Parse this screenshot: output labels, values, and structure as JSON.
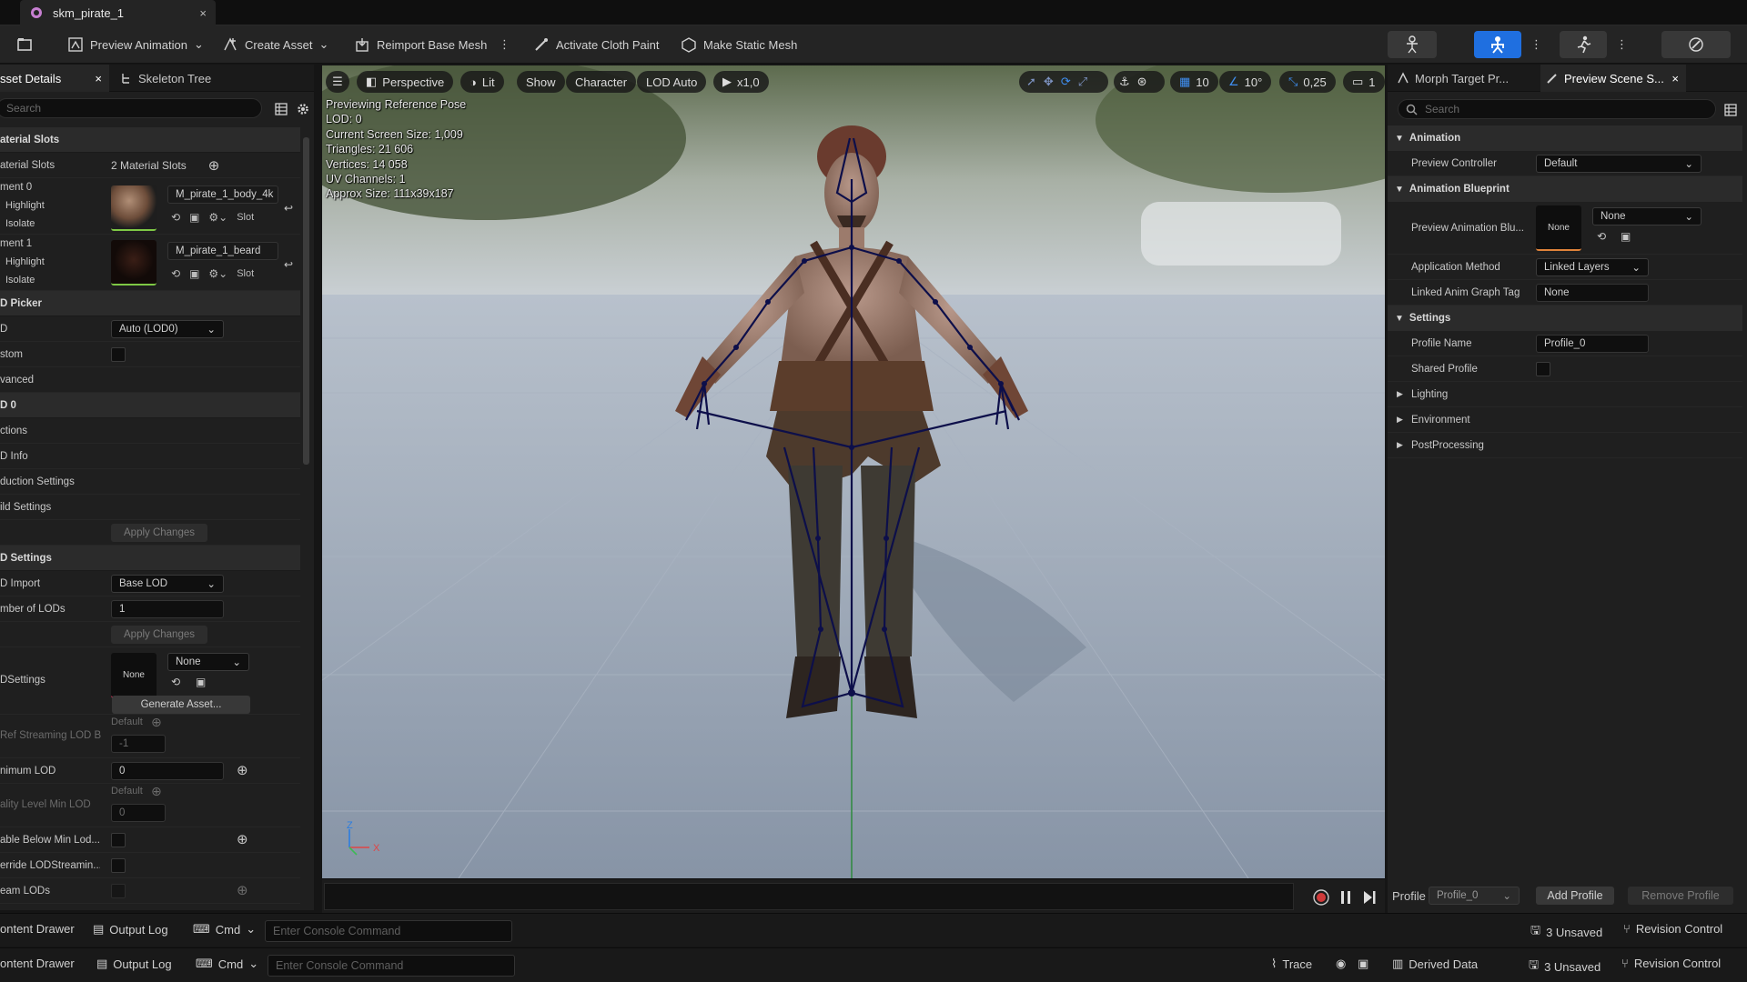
{
  "tab": {
    "title": "skm_pirate_1",
    "close": "×"
  },
  "toolbar": {
    "preview_animation": "Preview Animation",
    "create_asset": "Create Asset",
    "reimport": "Reimport Base Mesh",
    "cloth_paint": "Activate Cloth Paint",
    "make_static": "Make Static Mesh"
  },
  "left": {
    "tabs": [
      "sset Details",
      "Skeleton Tree"
    ],
    "search_placeholder": "Search",
    "rows": {
      "material_slots_cat": "aterial Slots",
      "material_slots_label": "aterial Slots",
      "material_slots_value": "2 Material Slots",
      "element0": "ment 0",
      "element1": "ment 1",
      "highlight": "Highlight",
      "isolate": "Isolate",
      "mat0_name": "M_pirate_1_body_4k",
      "mat1_name": "M_pirate_1_beard",
      "slot": "Slot",
      "lod_picker_cat": "D Picker",
      "lod_label": "D",
      "lod_value": "Auto (LOD0)",
      "custom": "stom",
      "advanced": "vanced",
      "lod0_cat": "D 0",
      "sections": "ctions",
      "lod_info": "D Info",
      "reduction": "duction Settings",
      "build": "ild Settings",
      "apply": "Apply Changes",
      "lod_settings_cat": "D Settings",
      "lod_import": "D Import",
      "lod_import_value": "Base LOD",
      "num_lods": "mber of LODs",
      "num_lods_value": "1",
      "apply2": "Apply Changes",
      "lodsettings": "DSettings",
      "none_thumb": "None",
      "none_dd": "None",
      "generate": "Generate Asset...",
      "minstream": "Ref Streaming LOD B",
      "default1": "Default",
      "minus1": "-1",
      "min_lod": "nimum LOD",
      "min_lod_value": "0",
      "quality": "ality Level Min LOD",
      "default2": "Default",
      "zero": "0",
      "disable_below": "able Below Min Lod...",
      "override": "erride LODStreamin...",
      "stream": "eam LODs"
    }
  },
  "viewport": {
    "menu_label": "",
    "perspective": "Perspective",
    "lit": "Lit",
    "show": "Show",
    "character": "Character",
    "lod": "LOD Auto",
    "speed": "x1,0",
    "grid": "10",
    "angle": "10°",
    "scale": "0,25",
    "cam": "1",
    "stats": [
      "Previewing Reference Pose",
      "LOD: 0",
      "Current Screen Size: 1,009",
      "Triangles: 21 606",
      "Vertices: 14 058",
      "UV Channels: 1",
      "Approx Size: 111x39x187"
    ],
    "axis_z": "Z",
    "axis_x": "X"
  },
  "right": {
    "tabs": [
      "Morph Target Pr...",
      "Preview Scene S..."
    ],
    "search_placeholder": "Search",
    "animation_cat": "Animation",
    "preview_controller": "Preview Controller",
    "preview_controller_value": "Default",
    "anim_bp_cat": "Animation Blueprint",
    "preview_anim_bp": "Preview Animation Blu...",
    "none_thumb": "None",
    "none_dd": "None",
    "application_method": "Application Method",
    "application_method_value": "Linked Layers",
    "linked_anim": "Linked Anim Graph Tag",
    "linked_anim_value": "None",
    "settings_cat": "Settings",
    "profile_name": "Profile Name",
    "profile_name_value": "Profile_0",
    "shared_profile": "Shared Profile",
    "lighting": "Lighting",
    "environment": "Environment",
    "postprocessing": "PostProcessing",
    "profile_label": "Profile",
    "profile_dd": "Profile_0",
    "add_profile": "Add Profile",
    "remove_profile": "Remove Profile"
  },
  "bottom1": {
    "content_drawer": "ontent Drawer",
    "output_log": "Output Log",
    "cmd": "Cmd",
    "console_placeholder": "Enter Console Command",
    "unsaved": "3 Unsaved",
    "revision": "Revision Control"
  },
  "bottom2": {
    "content_drawer": "ontent Drawer",
    "output_log": "Output Log",
    "cmd": "Cmd",
    "console_placeholder": "Enter Console Command",
    "trace": "Trace",
    "derived": "Derived Data",
    "unsaved": "3 Unsaved",
    "revision": "Revision Control"
  },
  "colors": {
    "accent": "#1f6fe0",
    "selected_tab": "#262626"
  }
}
